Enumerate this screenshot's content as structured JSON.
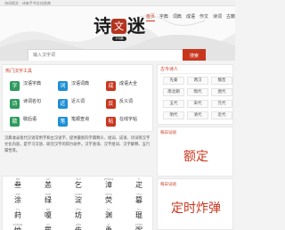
{
  "topbar": {
    "text": "诗词网文 · 诗来手书文化经典"
  },
  "nav": {
    "items": [
      "首页",
      "字典",
      "词典",
      "成语",
      "作文",
      "诗词",
      "古籍"
    ],
    "active_index": 0
  },
  "logo": {
    "title": "诗",
    "seal": "文",
    "title2": "迷",
    "subtitle": "字词典"
  },
  "search": {
    "placeholder": "输入汉字词",
    "button": "搜索"
  },
  "tools": {
    "title": "热门汉字工具",
    "items": [
      {
        "label": "汉语字典",
        "color": "#2e9a5d"
      },
      {
        "label": "汉语词典",
        "color": "#1d8fd6"
      },
      {
        "label": "成语大全",
        "color": "#c8361e"
      },
      {
        "label": "诗词名句",
        "color": "#2e9a5d"
      },
      {
        "label": "近义词",
        "color": "#1d8fd6"
      },
      {
        "label": "反义词",
        "color": "#c8361e"
      },
      {
        "label": "歇后语",
        "color": "#2e9a5d"
      },
      {
        "label": "笔顺查询",
        "color": "#1d8fd6"
      },
      {
        "label": "在线字帖",
        "color": "#c8361e"
      }
    ]
  },
  "intro": {
    "text": "汉典收录现代汉语常用字和古汉语字，提供最新的字典释义、组词、成语、诗词等汉字文化内容，是学习汉语、研究汉字的得力助手。汉字查询、汉字组词、汉字解释、五行属性等。"
  },
  "grid": {
    "cells": [
      {
        "py": "bā",
        "ch": "叁"
      },
      {
        "py": "yǔ",
        "ch": "恙"
      },
      {
        "py": "kuí",
        "ch": "乞"
      },
      {
        "py": "zhāng",
        "ch": "漳"
      },
      {
        "py": "lì",
        "ch": "疋"
      },
      {
        "py": "xiá",
        "ch": "涂"
      },
      {
        "py": "huò",
        "ch": "绿"
      },
      {
        "py": "yuán",
        "ch": "淀"
      },
      {
        "py": "yíng",
        "ch": "荧"
      },
      {
        "py": "chí",
        "ch": "篡"
      },
      {
        "py": "lú",
        "ch": "莳"
      },
      {
        "py": "bó",
        "ch": "嗄"
      },
      {
        "py": "fán",
        "ch": "坊"
      },
      {
        "py": "jù",
        "ch": "渊"
      },
      {
        "py": "lù",
        "ch": "琨"
      },
      {
        "py": "zhōng",
        "ch": "忡"
      },
      {
        "py": "pì",
        "ch": "罷"
      },
      {
        "py": "yǒu",
        "ch": "侑"
      },
      {
        "py": "yì",
        "ch": "恿"
      },
      {
        "py": "zhōu",
        "ch": "弼"
      }
    ]
  },
  "dynasty": {
    "title": "古今诗人",
    "items": [
      "先秦",
      "两汉",
      "魏晋",
      "南北朝",
      "隋代",
      "唐代",
      "五代",
      "宋代",
      "元代",
      "明代",
      "清代",
      "近代"
    ]
  },
  "daily_word": {
    "title": "每日词语",
    "word": "额定"
  },
  "daily_word2": {
    "title": "每日词语",
    "word": "定时炸弹"
  }
}
